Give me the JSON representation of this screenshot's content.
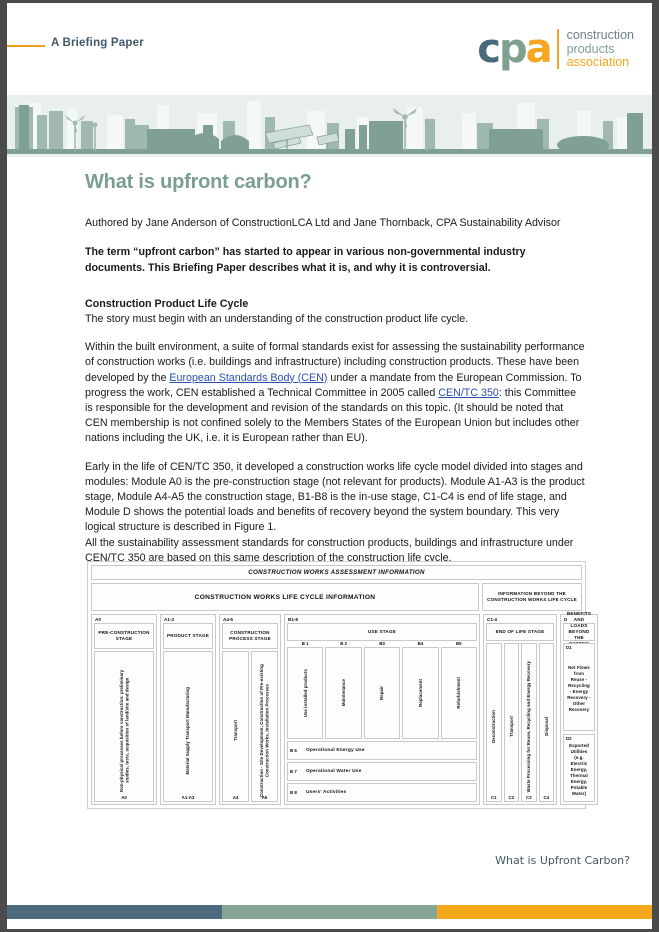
{
  "header": {
    "label": "A Briefing Paper",
    "logo": {
      "c": "c",
      "p": "p",
      "a": "a",
      "line1": "construction",
      "line2": "products",
      "line3": "association",
      "color_c": "#4a6a7d",
      "color_p": "#7fa08f",
      "color_a": "#f5a623"
    },
    "rule_color": "#f0a01e"
  },
  "banner": {
    "alt": "city-skyline-illustration",
    "bg": "#e9efee",
    "fill": "#7fa093"
  },
  "document": {
    "title": "What is upfront carbon?",
    "title_color": "#7a9d94",
    "byline": "Authored by Jane Anderson of ConstructionLCA Ltd and Jane Thornback, CPA Sustainability Advisor",
    "lede": "The term “upfront carbon” has started to appear in various non-governmental industry documents.  This Briefing Paper describes what it is, and why it is controversial.",
    "section_heading": "Construction Product Life Cycle",
    "section_intro": "The story must begin with an understanding of the construction product life cycle.",
    "para2_a": "Within the built environment, a suite of formal standards exist for assessing the sustainability performance of construction works (i.e. buildings and infrastructure) including construction products. These have been developed by the ",
    "link1": "European Standards Body (CEN)",
    "para2_b": " under a mandate from the European Commission.  To progress the work, CEN established a Technical Committee in 2005 called ",
    "link2": "CEN/TC 350",
    "para2_c": ": this Committee is responsible for the development and revision of the standards on this topic.  (It should be noted that CEN membership is not confined solely to the Members States of the European Union but includes other nations including the UK, i.e. it is European rather than EU).",
    "para3": "Early in the life of CEN/TC 350, it developed a construction works life cycle model divided into stages and modules:  Module A0 is the pre-construction stage (not relevant for products). Module A1-A3 is the product stage, Module A4-A5 the construction stage, B1-B8 is the in-use stage, C1-C4 is end of life stage, and Module D shows the potential loads and benefits of recovery beyond the system boundary.  This very logical structure is described in Figure 1.",
    "para4": "All the sustainability assessment standards for construction products, buildings and infrastructure under CEN/TC 350 are based on this same description of the construction life cycle.",
    "link_color": "#2b50b0"
  },
  "figure": {
    "band_top": "CONSTRUCTION WORKS ASSESSMENT INFORMATION",
    "band_left": "CONSTRUCTION WORKS LIFE CYCLE INFORMATION",
    "band_right": "INFORMATION BEYOND THE CONSTRUCTION WORKS LIFE CYCLE",
    "stages": [
      {
        "code": "A0",
        "name": "PRE-CONSTRUCTION STAGE",
        "modules": [
          {
            "code": "A0",
            "label": "Non-physical processes before construction: preliminary studies, tests, acquisition of land/site and design"
          }
        ]
      },
      {
        "code": "A1-3",
        "name": "PRODUCT STAGE",
        "modules": [
          {
            "code": "A1-A3",
            "label": "Material Supply Transport Manufacturing"
          }
        ]
      },
      {
        "code": "A4-5",
        "name": "CONSTRUCTION PROCESS STAGE",
        "modules": [
          {
            "code": "A4",
            "label": "Transport"
          },
          {
            "code": "A5",
            "label": "Construction - Site Development, Construction of Pre-existing Construction Works, Installation Processes"
          }
        ]
      },
      {
        "code": "C1-4",
        "name": "END OF LIFE STAGE",
        "modules": [
          {
            "code": "C1",
            "label": "Deconstruction"
          },
          {
            "code": "C2",
            "label": "Transport"
          },
          {
            "code": "C3",
            "label": "Waste Processing for Reuse, Recycling and Energy Recovery"
          },
          {
            "code": "C4",
            "label": "Disposal"
          }
        ]
      }
    ],
    "use_stage": {
      "code": "B1-8",
      "name": "USE STAGE",
      "sub_modules": [
        {
          "code": "B 1",
          "label": "Use installed products"
        },
        {
          "code": "B 2",
          "label": "Maintenance"
        },
        {
          "code": "B3",
          "label": "Repair"
        },
        {
          "code": "B4",
          "label": "Replacement"
        },
        {
          "code": "B5",
          "label": "Refurbishment"
        }
      ],
      "rows": [
        {
          "code": "B 6",
          "label": "Operational Energy Use"
        },
        {
          "code": "B 7",
          "label": "Operational Water Use"
        },
        {
          "code": "B 8",
          "label": "Users' Activities"
        }
      ]
    },
    "beyond": {
      "code": "D",
      "name": "BENEFITS AND LOADS BEYOND THE SYSTEM BOUNDARY",
      "cells": [
        {
          "code": "D1",
          "label": "Net Flows from Reuse - Recycling - Energy Recovery - Other Recovery"
        },
        {
          "code": "D2",
          "label": "Exported Utilities (e.g. Electric Energy, Thermal Energy, Potable Water)"
        }
      ]
    }
  },
  "footer": {
    "text": "What is Upfront Carbon?",
    "bar_colors": [
      "#4d6a7f",
      "#85a596",
      "#f5a81c"
    ]
  }
}
